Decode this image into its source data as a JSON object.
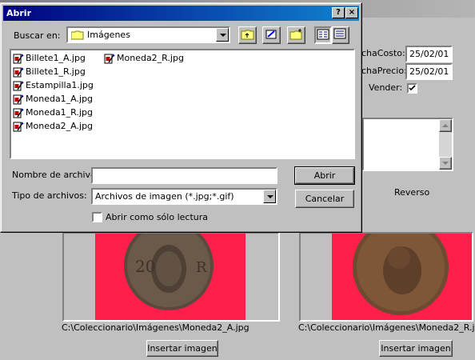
{
  "dialog": {
    "title": "Abrir",
    "help_label": "?",
    "close_label": "×",
    "look_in_label": "Buscar en:",
    "look_in_value": "Imágenes",
    "files": [
      {
        "name": "Billete1_A.jpg"
      },
      {
        "name": "Billete1_R.jpg"
      },
      {
        "name": "Estampilla1.jpg"
      },
      {
        "name": "Moneda1_A.jpg"
      },
      {
        "name": "Moneda1_R.jpg"
      },
      {
        "name": "Moneda2_A.jpg"
      },
      {
        "name": "Moneda2_R.jpg"
      }
    ],
    "filename_label": "Nombre de archivo:",
    "filename_value": "",
    "filetype_label": "Tipo de archivos:",
    "filetype_value": "Archivos de imagen (*.jpg;*.gif)",
    "open_button": "Abrir",
    "cancel_button": "Cancelar",
    "readonly_label": "Abrir como sólo lectura",
    "readonly_checked": false
  },
  "background_form": {
    "fecha_costo_label": "chaCosto:",
    "fecha_costo_value": "25/02/01",
    "fecha_precio_label": "chaPrecio:",
    "fecha_precio_value": "25/02/01",
    "vender_label": "Vender:",
    "vender_checked": true,
    "reverso_label": "Reverso",
    "front_image_path": "C:\\Coleccionario\\Imágenes\\Moneda2_A.jpg",
    "back_image_path": "C:\\Coleccionario\\Imágenes\\Moneda2_R.jpg",
    "insert_front_button": "Insertar imagen",
    "insert_back_button": "Insertar imagen"
  },
  "colors": {
    "dialog_title_start": "#000080",
    "dialog_title_end": "#1084d0",
    "image_background": "#ff1f4a",
    "face": "#c0c0c0"
  }
}
